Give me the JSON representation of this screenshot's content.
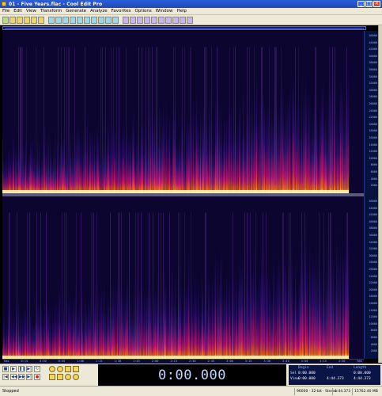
{
  "window": {
    "title": "01 - Five Years.flac - Cool Edit Pro",
    "buttons": [
      "_",
      "□",
      "×"
    ]
  },
  "menu": [
    "File",
    "Edit",
    "View",
    "Transform",
    "Generate",
    "Analyze",
    "Favorites",
    "Options",
    "Window",
    "Help"
  ],
  "display": {
    "time": "0:00.000"
  },
  "selection": {
    "headers": [
      "Begin",
      "End",
      "Length"
    ],
    "rows": [
      {
        "label": "Sel",
        "begin": "0:00.000",
        "end": "",
        "length": "0:00.000"
      },
      {
        "label": "View",
        "begin": "0:00.000",
        "end": "4:44.373",
        "length": "4:44.373"
      }
    ]
  },
  "status": {
    "text": "Stopped",
    "format": "96000 · 32-bit · Stereo",
    "duration": "4:44.373",
    "free": "15762.40 MB free"
  },
  "timeline": {
    "labels": [
      "hms",
      "0:15",
      "0:30",
      "0:45",
      "1:00",
      "1:15",
      "1:30",
      "1:45",
      "2:00",
      "2:15",
      "2:30",
      "2:45",
      "3:00",
      "3:15",
      "3:30",
      "3:45",
      "4:00",
      "4:15",
      "4:30",
      "hms"
    ]
  },
  "freq_scale": {
    "labels": [
      "46000",
      "44000",
      "42000",
      "40000",
      "38000",
      "36000",
      "34000",
      "32000",
      "30000",
      "28000",
      "26000",
      "24000",
      "22000",
      "20000",
      "18000",
      "16000",
      "14000",
      "12000",
      "10000",
      "8000",
      "6000",
      "4000",
      "2000"
    ]
  },
  "colors": {
    "background": "#0c0530",
    "low_energy": "#2a0f6b",
    "mid_energy": "#c21575",
    "high_energy": "#ff6a1a",
    "peak_energy": "#fff3a8"
  }
}
